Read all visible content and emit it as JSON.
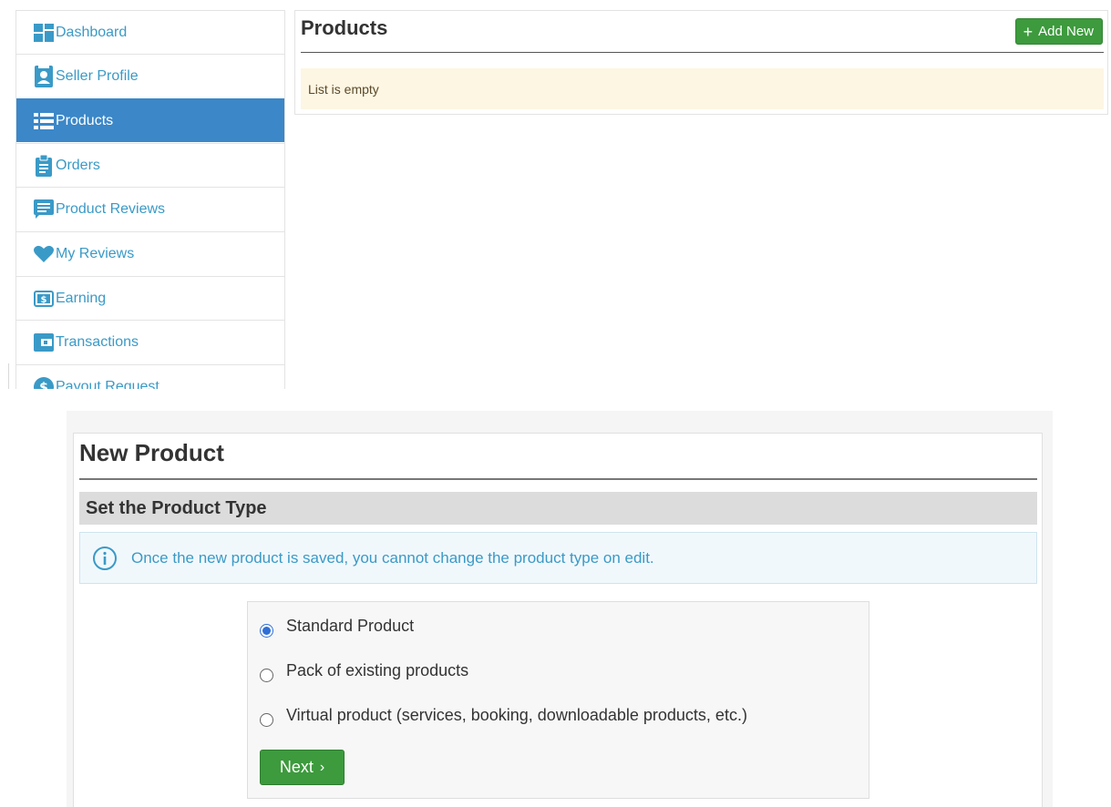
{
  "sidebar": {
    "items": [
      {
        "label": "Dashboard",
        "icon": "dashboard-icon"
      },
      {
        "label": "Seller Profile",
        "icon": "profile-card-icon"
      },
      {
        "label": "Products",
        "icon": "list-icon",
        "active": true
      },
      {
        "label": "Orders",
        "icon": "clipboard-icon"
      },
      {
        "label": "Product Reviews",
        "icon": "comment-icon"
      },
      {
        "label": "My Reviews",
        "icon": "heart-icon"
      },
      {
        "label": "Earning",
        "icon": "money-icon"
      },
      {
        "label": "Transactions",
        "icon": "wallet-icon"
      },
      {
        "label": "Payout Request",
        "icon": "dollar-circle-icon"
      }
    ]
  },
  "products": {
    "title": "Products",
    "add_new_label": "Add New",
    "add_new_icon": "+",
    "empty_message": "List is empty"
  },
  "new_product": {
    "title": "New Product",
    "section_title": "Set the Product Type",
    "info_text": "Once the new product is saved, you cannot change the product type on edit.",
    "options": [
      {
        "label": "Standard Product",
        "checked": true
      },
      {
        "label": "Pack of existing products",
        "checked": false
      },
      {
        "label": "Virtual product (services, booking, downloadable products, etc.)",
        "checked": false
      }
    ],
    "next_label": "Next",
    "next_icon": "›"
  },
  "colors": {
    "accent": "#3a9ac7",
    "active_bg": "#3b87c8",
    "success": "#3d9a3d",
    "warning_bg": "#fdf6e3",
    "info_bg": "#f1f8fc"
  }
}
